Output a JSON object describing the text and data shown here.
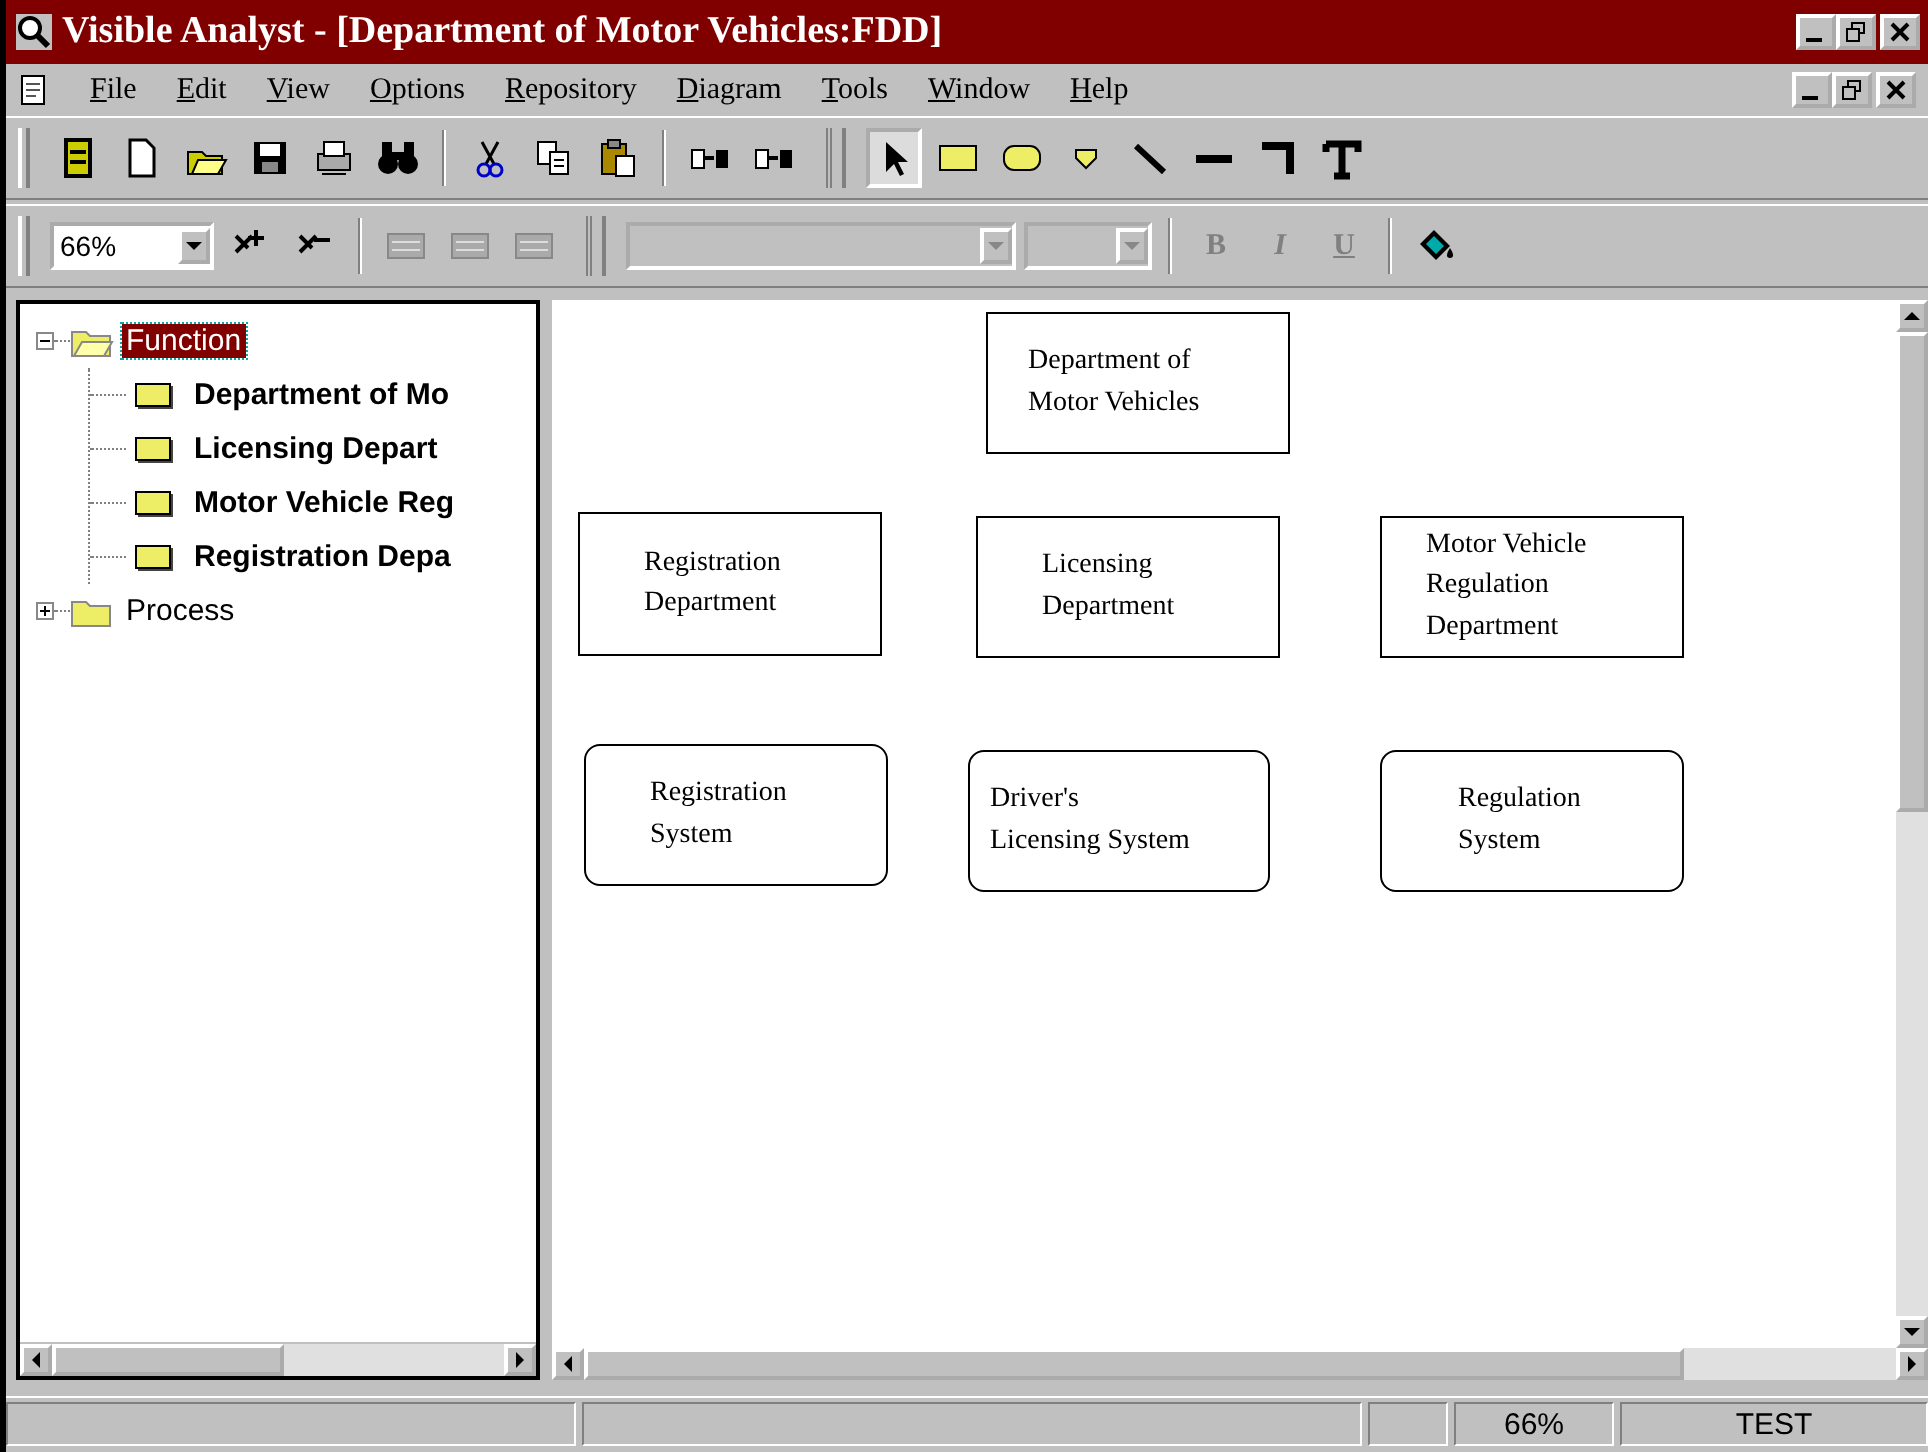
{
  "window": {
    "title": "Visible Analyst - [Department of Motor Vehicles:FDD]"
  },
  "menu": [
    "File",
    "Edit",
    "View",
    "Options",
    "Repository",
    "Diagram",
    "Tools",
    "Window",
    "Help"
  ],
  "toolbar": [
    {
      "kind": "database",
      "selected": false
    },
    {
      "kind": "new",
      "selected": false
    },
    {
      "kind": "open",
      "selected": false
    },
    {
      "kind": "save",
      "selected": false
    },
    {
      "kind": "print",
      "selected": false
    },
    {
      "kind": "find",
      "selected": false
    },
    {
      "kind": "sep"
    },
    {
      "kind": "cut",
      "selected": false
    },
    {
      "kind": "copy",
      "selected": false
    },
    {
      "kind": "paste",
      "selected": false
    },
    {
      "kind": "sep"
    },
    {
      "kind": "link",
      "selected": false
    },
    {
      "kind": "link",
      "selected": false
    },
    {
      "kind": "grip"
    },
    {
      "kind": "pointer",
      "selected": true
    },
    {
      "kind": "rect",
      "selected": false
    },
    {
      "kind": "rounded",
      "selected": false
    },
    {
      "kind": "shield",
      "selected": false
    },
    {
      "kind": "diagonal",
      "selected": false
    },
    {
      "kind": "hline",
      "selected": false
    },
    {
      "kind": "corner",
      "selected": false
    },
    {
      "kind": "text",
      "selected": false
    }
  ],
  "format_bar": {
    "zoom": "66%",
    "bold": "B",
    "italic": "I",
    "underline": "U"
  },
  "tree": [
    {
      "label": "Function",
      "expanded": true,
      "selected": true,
      "children": [
        {
          "label": "Department of Mo"
        },
        {
          "label": "Licensing Depart"
        },
        {
          "label": "Motor Vehicle Reg"
        },
        {
          "label": "Registration Depa"
        }
      ]
    },
    {
      "label": "Process",
      "expanded": false,
      "selected": false
    }
  ],
  "diagram": {
    "nodes": [
      {
        "label": "Department of Motor Vehicles",
        "kind": "function"
      },
      {
        "label": "Registration Department",
        "kind": "function"
      },
      {
        "label": "Licensing Department",
        "kind": "function"
      },
      {
        "label": "Motor Vehicle Regulation Department",
        "kind": "function"
      },
      {
        "label": "Registration System",
        "kind": "system"
      },
      {
        "label": "Driver's Licensing System",
        "kind": "system"
      },
      {
        "label": "Regulation System",
        "kind": "system"
      }
    ]
  },
  "status_bar": [
    "66%",
    "TEST"
  ]
}
